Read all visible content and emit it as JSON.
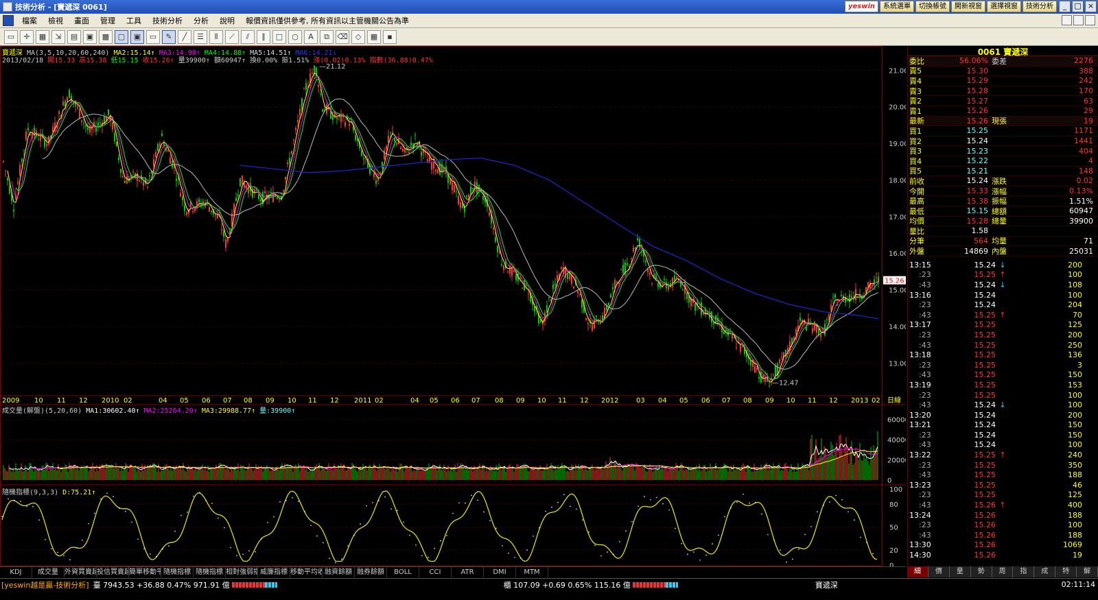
{
  "window": {
    "title": "技術分析 - [寶遞深 0061]"
  },
  "top_buttons": [
    "yeswin",
    "系統選單",
    "切換帳號",
    "開新視窗",
    "選擇視窗",
    "技術分析"
  ],
  "menu": [
    "檔案",
    "檢視",
    "畫面",
    "管理",
    "工具",
    "技術分析",
    "分析",
    "說明",
    "報價資訊僅供參考, 所有資訊以主管機關公告為準"
  ],
  "legend": {
    "line1": [
      {
        "t": "寶遞深",
        "c": "#ff0"
      },
      {
        "t": " MA(3,5,10,20,60,240) ",
        "c": "#ccc"
      },
      {
        "t": "MA2:15.14↑",
        "c": "#ff0"
      },
      {
        "t": " MA3:14.98↑",
        "c": "#f0f"
      },
      {
        "t": " MA4:14.88↑",
        "c": "#0f0"
      },
      {
        "t": " MA5:14.51↑",
        "c": "#ddd"
      },
      {
        "t": " MA6:14.21↓",
        "c": "#33f"
      }
    ],
    "line2": [
      {
        "t": "2013/02/18 ",
        "c": "#ccc"
      },
      {
        "t": "開15.33",
        "c": "#f33"
      },
      {
        "t": " 高15.38",
        "c": "#f33"
      },
      {
        "t": " 低15.15",
        "c": "#0f0"
      },
      {
        "t": " 收15.26↑",
        "c": "#f33"
      },
      {
        "t": " 量39900↑",
        "c": "#ccc"
      },
      {
        "t": " 額60947↑",
        "c": "#ccc"
      },
      {
        "t": " 換0.00%",
        "c": "#ccc"
      },
      {
        "t": " 振1.51%",
        "c": "#ccc"
      },
      {
        "t": " 漲(0.02)0.13%",
        "c": "#f33"
      },
      {
        "t": " 指數(36.88)0.47%",
        "c": "#f33"
      }
    ]
  },
  "vol_legend": [
    {
      "t": "成交量(解盤)(5,20,60) ",
      "c": "#ccc"
    },
    {
      "t": "MA1:30602.40↑",
      "c": "#fff"
    },
    {
      "t": " MA2:25264.20↑",
      "c": "#f0f"
    },
    {
      "t": " MA3:29988.77↑",
      "c": "#ff0"
    },
    {
      "t": " 量:39900↑",
      "c": "#6ff"
    }
  ],
  "kd_legend": [
    {
      "t": "隨機指標(9,3,3) ",
      "c": "#ccc"
    },
    {
      "t": "D:75.21↑",
      "c": "#ff0"
    }
  ],
  "axes": {
    "price_ticks": [
      "21.00",
      "20.00",
      "19.00",
      "18.00",
      "17.00",
      "16.00",
      "15.00",
      "14.00",
      "13.00"
    ],
    "vol_ticks": [
      "60000",
      "40000",
      "20000",
      "0"
    ],
    "kd_ticks": [
      "100",
      "80",
      "50",
      "20",
      "0"
    ],
    "date_labels": [
      "2009",
      "10",
      "11",
      "12",
      "2010",
      "02",
      "04",
      "05",
      "06",
      "07",
      "08",
      "09",
      "10",
      "11",
      "12",
      "2011",
      "02",
      "04",
      "05",
      "06",
      "07",
      "08",
      "09",
      "10",
      "11",
      "12",
      "2012",
      "03",
      "04",
      "05",
      "06",
      "07",
      "08",
      "09",
      "10",
      "11",
      "12",
      "2013",
      "02"
    ],
    "date_unit": "日線",
    "high_label": "21.12",
    "low_label": "12.47",
    "last_label": "15.26"
  },
  "quote": {
    "title": "0061 寶遞深",
    "top": {
      "l": "委比",
      "v": "56.06%",
      "l2": "委差",
      "v2": "2276"
    },
    "asks": [
      {
        "l": "賣5",
        "v": "15.30",
        "q": "388"
      },
      {
        "l": "賣4",
        "v": "15.29",
        "q": "242"
      },
      {
        "l": "賣3",
        "v": "15.28",
        "q": "170"
      },
      {
        "l": "賣2",
        "v": "15.27",
        "q": "63"
      },
      {
        "l": "賣1",
        "v": "15.26",
        "q": "29"
      }
    ],
    "last": {
      "l": "最新",
      "v": "15.26",
      "l2": "現張",
      "v2": "19"
    },
    "bids": [
      {
        "l": "買1",
        "v": "15.25",
        "q": "1171"
      },
      {
        "l": "買2",
        "v": "15.24",
        "q": "1441"
      },
      {
        "l": "買3",
        "v": "15.23",
        "q": "404"
      },
      {
        "l": "買4",
        "v": "15.22",
        "q": "4"
      },
      {
        "l": "買5",
        "v": "15.21",
        "q": "148"
      }
    ],
    "stats": [
      {
        "l": "前收",
        "v": "15.24",
        "l2": "漲跌",
        "v2": "0.02"
      },
      {
        "l": "今開",
        "v": "15.33",
        "l2": "漲幅",
        "v2": "0.13%"
      },
      {
        "l": "最高",
        "v": "15.38",
        "l2": "振幅",
        "v2": "1.51%"
      },
      {
        "l": "最低",
        "v": "15.15",
        "l2": "總額",
        "v2": "60947"
      },
      {
        "l": "均價",
        "v": "15.28",
        "l2": "總量",
        "v2": "39900"
      },
      {
        "l": "量比",
        "v": "1.58",
        "l2": "",
        "v2": ""
      },
      {
        "l": "分筆",
        "v": "564",
        "l2": "均量",
        "v2": "71"
      },
      {
        "l": "外盤",
        "v": "14869",
        "l2": "內盤",
        "v2": "25031"
      }
    ],
    "ticks": [
      {
        "t": "13:15",
        "p": "15.24",
        "a": "↓",
        "q": "200",
        "dn": true,
        "sub": false
      },
      {
        "t": ":23",
        "p": "15.25",
        "a": "↑",
        "q": "100",
        "dn": false,
        "sub": true
      },
      {
        "t": ":43",
        "p": "15.24",
        "a": "↓",
        "q": "108",
        "dn": true,
        "sub": true
      },
      {
        "t": "13:16",
        "p": "15.24",
        "a": "",
        "q": "100",
        "dn": true,
        "sub": false
      },
      {
        "t": ":23",
        "p": "15.24",
        "a": "",
        "q": "204",
        "dn": true,
        "sub": true
      },
      {
        "t": ":43",
        "p": "15.25",
        "a": "↑",
        "q": "70",
        "dn": false,
        "sub": true
      },
      {
        "t": "13:17",
        "p": "15.25",
        "a": "",
        "q": "125",
        "dn": false,
        "sub": false
      },
      {
        "t": ":23",
        "p": "15.25",
        "a": "",
        "q": "200",
        "dn": false,
        "sub": true
      },
      {
        "t": ":43",
        "p": "15.25",
        "a": "",
        "q": "250",
        "dn": false,
        "sub": true
      },
      {
        "t": "13:18",
        "p": "15.25",
        "a": "",
        "q": "136",
        "dn": false,
        "sub": false
      },
      {
        "t": ":23",
        "p": "15.25",
        "a": "",
        "q": "3",
        "dn": false,
        "sub": true
      },
      {
        "t": ":43",
        "p": "15.25",
        "a": "",
        "q": "150",
        "dn": false,
        "sub": true
      },
      {
        "t": "13:19",
        "p": "15.25",
        "a": "",
        "q": "153",
        "dn": false,
        "sub": false
      },
      {
        "t": ":23",
        "p": "15.25",
        "a": "",
        "q": "100",
        "dn": false,
        "sub": true
      },
      {
        "t": ":43",
        "p": "15.24",
        "a": "↓",
        "q": "100",
        "dn": true,
        "sub": true
      },
      {
        "t": "13:20",
        "p": "15.24",
        "a": "",
        "q": "200",
        "dn": true,
        "sub": false
      },
      {
        "t": "13:21",
        "p": "15.24",
        "a": "",
        "q": "150",
        "dn": true,
        "sub": false
      },
      {
        "t": ":23",
        "p": "15.24",
        "a": "",
        "q": "150",
        "dn": true,
        "sub": true
      },
      {
        "t": ":43",
        "p": "15.24",
        "a": "",
        "q": "100",
        "dn": true,
        "sub": true
      },
      {
        "t": "13:22",
        "p": "15.25",
        "a": "↑",
        "q": "240",
        "dn": false,
        "sub": false
      },
      {
        "t": ":23",
        "p": "15.25",
        "a": "",
        "q": "350",
        "dn": false,
        "sub": true
      },
      {
        "t": ":43",
        "p": "15.25",
        "a": "",
        "q": "188",
        "dn": false,
        "sub": true
      },
      {
        "t": "13:23",
        "p": "15.25",
        "a": "",
        "q": "46",
        "dn": false,
        "sub": false
      },
      {
        "t": ":23",
        "p": "15.25",
        "a": "",
        "q": "125",
        "dn": false,
        "sub": true
      },
      {
        "t": ":43",
        "p": "15.26",
        "a": "↑",
        "q": "400",
        "dn": false,
        "sub": true
      },
      {
        "t": "13:24",
        "p": "15.26",
        "a": "",
        "q": "188",
        "dn": false,
        "sub": false
      },
      {
        "t": ":23",
        "p": "15.26",
        "a": "",
        "q": "100",
        "dn": false,
        "sub": true
      },
      {
        "t": ":43",
        "p": "15.26",
        "a": "",
        "q": "188",
        "dn": false,
        "sub": true
      },
      {
        "t": "13:30",
        "p": "15.26",
        "a": "",
        "q": "1069",
        "dn": false,
        "sub": false
      },
      {
        "t": "14:30",
        "p": "15.26",
        "a": "",
        "q": "19",
        "dn": false,
        "sub": false
      }
    ]
  },
  "bottom_tabs": [
    "KDJ",
    "成交量",
    "外資買賣超",
    "投信買賣超",
    "簡單移動平",
    "隨機指標",
    "隨機指標",
    "相對強弱指",
    "威廉指標",
    "移動平均收",
    "融資餘額",
    "融券餘額",
    "BOLL",
    "CCI",
    "ATR",
    "DMI",
    "MTM"
  ],
  "right_tabs": [
    "細",
    "價",
    "量",
    "勢",
    "周",
    "指",
    "成",
    "特",
    "解"
  ],
  "status": {
    "brand": "[yeswin越是贏-技術分析]",
    "idx1": "臺 7943.53 +36.88 0.47% 971.91 億",
    "idx2": "櫃 107.09 +0.69 0.65% 115.16 億",
    "stock": "寶遞深",
    "time": "02:11:14"
  }
}
